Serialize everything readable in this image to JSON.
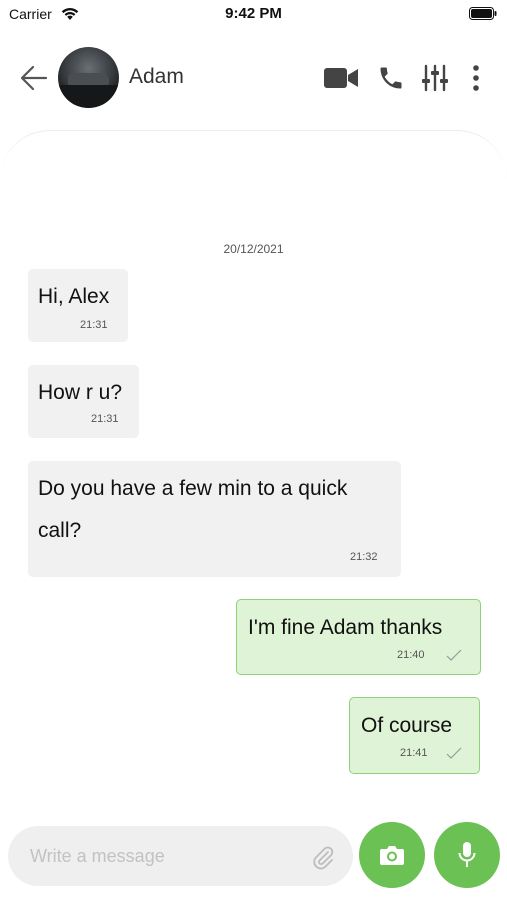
{
  "status_bar": {
    "carrier": "Carrier",
    "time": "9:42 PM"
  },
  "header": {
    "contact_name": "Adam",
    "icons": [
      "back-arrow-icon",
      "video-call-icon",
      "phone-icon",
      "sliders-icon",
      "more-vertical-icon"
    ]
  },
  "chat": {
    "date": "20/12/2021",
    "messages": [
      {
        "direction": "incoming",
        "text": "Hi, Alex",
        "time": "21:31"
      },
      {
        "direction": "incoming",
        "text": "How r u?",
        "time": "21:31"
      },
      {
        "direction": "incoming",
        "text_line1": "Do you have a few min to a quick",
        "text_line2": "call?",
        "time": "21:32"
      },
      {
        "direction": "outgoing",
        "text": "I'm fine Adam thanks",
        "time": "21:40",
        "status": "sent"
      },
      {
        "direction": "outgoing",
        "text": "Of course",
        "time": "21:41",
        "status": "sent"
      }
    ]
  },
  "composer": {
    "placeholder": "Write a message",
    "value": ""
  },
  "colors": {
    "accent": "#6cc155",
    "outgoing_bubble": "#dff3d6",
    "outgoing_border": "#8fd27a",
    "incoming_bubble": "#f1f1f1"
  }
}
